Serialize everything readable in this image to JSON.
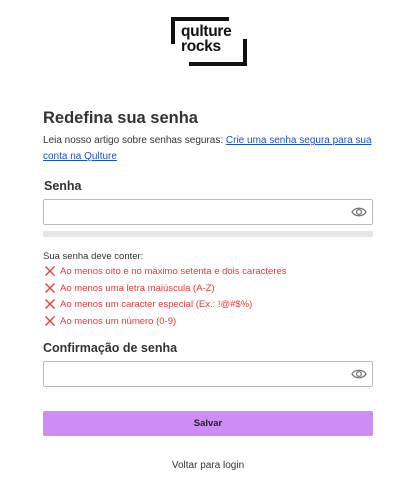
{
  "brand": {
    "line1": "qulture",
    "line2": "rocks"
  },
  "page": {
    "title": "Redefina sua senha"
  },
  "article": {
    "prefix": "Leia nosso artigo sobre senhas seguras: ",
    "link_text": "Crie uma senha segura para sua conta na Qulture"
  },
  "password": {
    "label": "Senha",
    "value": "",
    "placeholder": ""
  },
  "requirements": {
    "heading": "Sua senha deve conter:",
    "items": [
      {
        "text": "Ao menos oito e no máximo setenta e dois caracteres",
        "met": false
      },
      {
        "text": "Ao menos uma letra maiúscula (A-Z)",
        "met": false
      },
      {
        "text": "Ao menos um caracter especial (Ex.: !@#$%)",
        "met": false
      },
      {
        "text": "Ao menos um número (0-9)",
        "met": false
      }
    ]
  },
  "strength": {
    "fill": 0
  },
  "confirm": {
    "label": "Confirmação de senha",
    "value": "",
    "placeholder": ""
  },
  "actions": {
    "save_label": "Salvar",
    "back_label": "Voltar para login"
  },
  "colors": {
    "accent": "#cc8ef5",
    "error": "#e53935",
    "link": "#1a4fcf"
  },
  "icons": {
    "eye": "eye-icon",
    "fail": "x-icon"
  }
}
